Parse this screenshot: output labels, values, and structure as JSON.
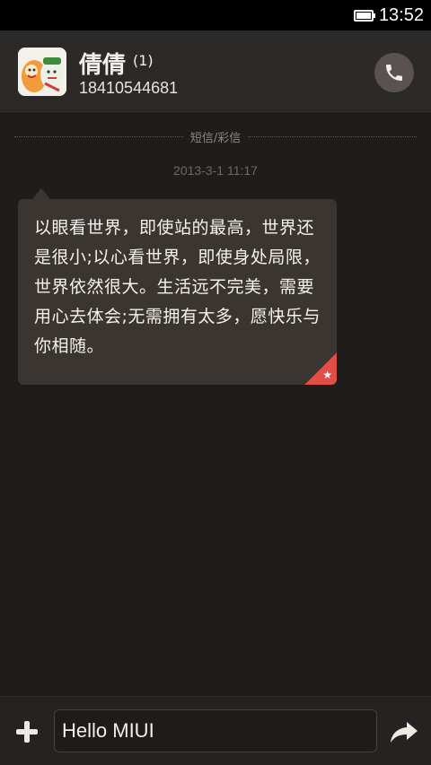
{
  "status_bar": {
    "time": "13:52",
    "battery_icon": "battery-icon"
  },
  "header": {
    "contact_name": "倩倩",
    "unread_count": "(1)",
    "phone_number": "18410544681",
    "avatar_icon": "contact-avatar",
    "call_icon": "phone-icon"
  },
  "conversation": {
    "type_label": "短信/彩信",
    "timestamp": "2013-3-1 11:17",
    "messages": [
      {
        "text": "以眼看世界，即使站的最高，世界还是很小;以心看世界，即使身处局限，世界依然很大。生活远不完美，需要用心去体会;无需拥有太多，愿快乐与你相随。",
        "starred": true
      }
    ]
  },
  "composer": {
    "value": "Hello MIUI",
    "add_icon": "plus-icon",
    "send_icon": "send-arrow-icon"
  },
  "colors": {
    "background": "#1f1d1c",
    "header": "#2c2a28",
    "bubble": "#3b3532",
    "star_accent": "#e14e45"
  }
}
